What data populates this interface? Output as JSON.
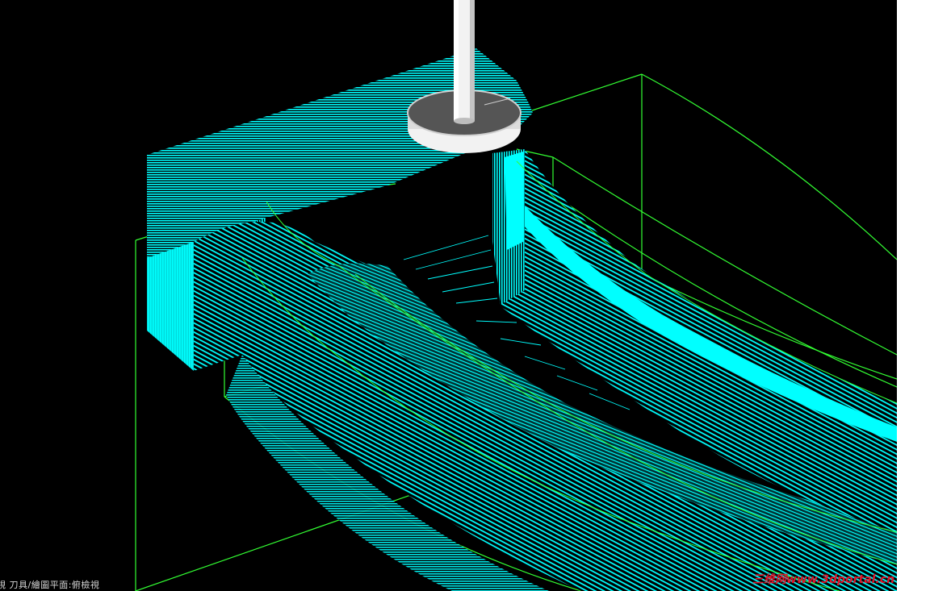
{
  "status": {
    "text": "視  刀具/繪圖平面:俯檢視"
  },
  "watermark": {
    "cn": "三维网",
    "domain": "www.3dportal.cn"
  },
  "colors": {
    "background": "#000000",
    "toolpath": "#00ffff",
    "boundary": "#33ff33",
    "tool_shank": "#f2f2f2",
    "tool_holder": "#555555",
    "status_text": "#d8d8d8"
  }
}
